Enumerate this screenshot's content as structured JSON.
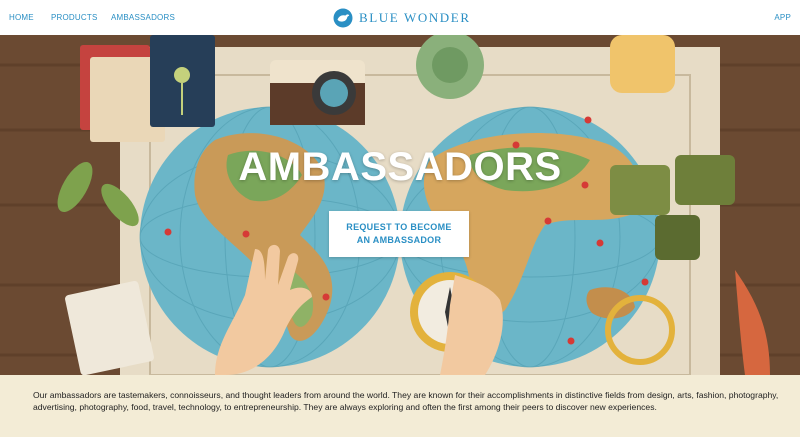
{
  "nav": {
    "links": [
      "HOME",
      "PRODUCTS",
      "AMBASSADORS"
    ],
    "brand": "BLUE WONDER",
    "app": "APP"
  },
  "hero": {
    "title": "AMBASSADORS",
    "cta_line1": "REQUEST TO BECOME",
    "cta_line2": "AN AMBASSADOR"
  },
  "intro": {
    "text": "Our ambassadors are tastemakers, connoisseurs, and thought leaders from around the world. They are known for their accomplishments in distinctive fields from design, arts, fashion, photography, advertising, photography, food, travel, technology, to entrepreneurship. They are always exploring and often the first among their peers to discover new experiences."
  },
  "colors": {
    "accent": "#2a8fc4",
    "wood": "#6b4a32",
    "intro_bg": "#f3ecd6"
  }
}
